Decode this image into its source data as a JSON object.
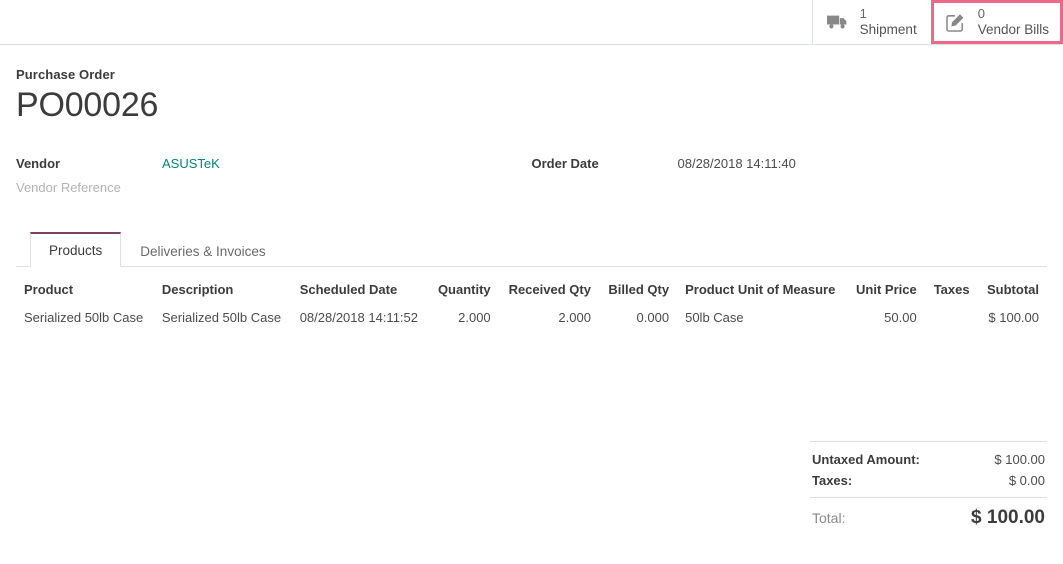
{
  "statusbar": {
    "buttons": [
      {
        "icon": "truck-icon",
        "count": "1",
        "label": "Shipment",
        "highlighted": false
      },
      {
        "icon": "pencil-square-icon",
        "count": "0",
        "label": "Vendor Bills",
        "highlighted": true
      }
    ]
  },
  "record": {
    "subtitle": "Purchase Order",
    "title": "PO00026"
  },
  "fields": {
    "left": [
      {
        "label": "Vendor",
        "value": "ASUSTeK",
        "style": "link"
      },
      {
        "label": "Vendor Reference",
        "value": "",
        "style": "muted"
      }
    ],
    "right": [
      {
        "label": "Order Date",
        "value": "08/28/2018 14:11:40",
        "style": "plain"
      }
    ]
  },
  "notebook": {
    "tabs": [
      {
        "label": "Products",
        "active": true
      },
      {
        "label": "Deliveries & Invoices",
        "active": false
      }
    ]
  },
  "lines": {
    "columns": [
      {
        "label": "Product",
        "align": "left"
      },
      {
        "label": "Description",
        "align": "left"
      },
      {
        "label": "Scheduled Date",
        "align": "left"
      },
      {
        "label": "Quantity",
        "align": "right"
      },
      {
        "label": "Received Qty",
        "align": "right"
      },
      {
        "label": "Billed Qty",
        "align": "right"
      },
      {
        "label": "Product Unit of Measure",
        "align": "left"
      },
      {
        "label": "Unit Price",
        "align": "right"
      },
      {
        "label": "Taxes",
        "align": "right"
      },
      {
        "label": "Subtotal",
        "align": "right"
      }
    ],
    "rows": [
      {
        "product": "Serialized 50lb Case",
        "description": "Serialized 50lb Case",
        "scheduled_date": "08/28/2018 14:11:52",
        "quantity": "2.000",
        "received_qty": "2.000",
        "billed_qty": "0.000",
        "uom": "50lb Case",
        "unit_price": "50.00",
        "taxes": "",
        "subtotal": "$ 100.00"
      }
    ]
  },
  "totals": {
    "untaxed_label": "Untaxed Amount:",
    "untaxed_value": "$ 100.00",
    "taxes_label": "Taxes:",
    "taxes_value": "$ 0.00",
    "total_label": "Total:",
    "total_value": "$ 100.00"
  },
  "colors": {
    "highlight": "#eb6a8a",
    "link": "#00847e",
    "active_tab": "#7d3f63"
  }
}
